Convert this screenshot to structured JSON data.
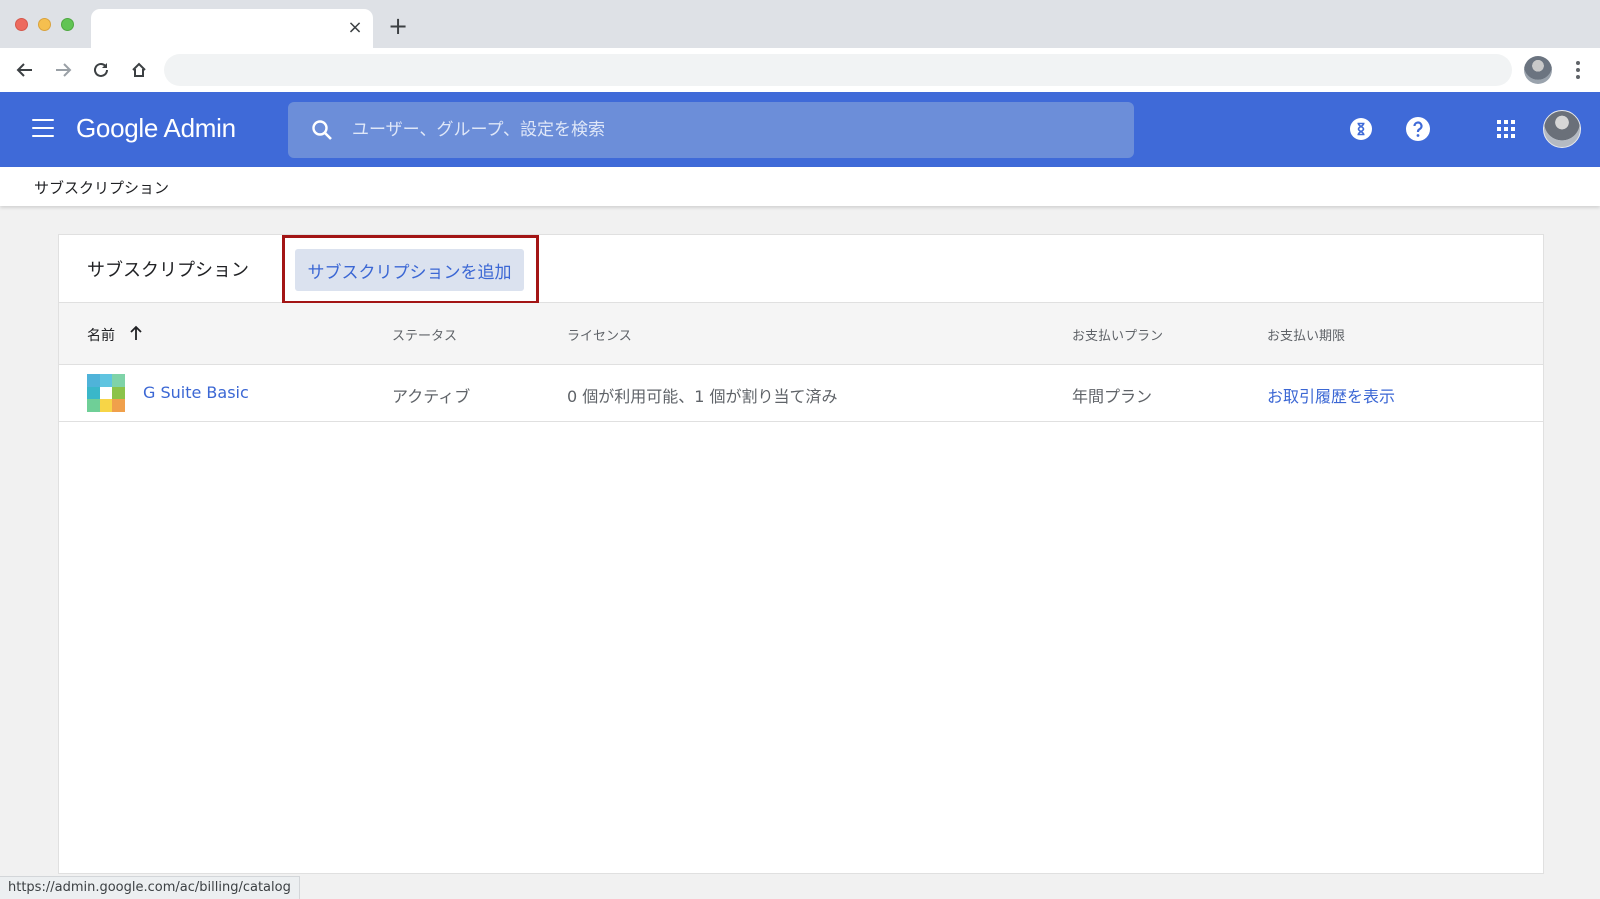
{
  "browser": {
    "tab_close_glyph": "×",
    "new_tab_glyph": "+",
    "status_url": "https://admin.google.com/ac/billing/catalog"
  },
  "header": {
    "brand_google": "Google",
    "brand_admin": "Admin",
    "search_placeholder": "ユーザー、グループ、設定を検索",
    "accent_color": "#3f6ad8"
  },
  "breadcrumb": {
    "current": "サブスクリプション"
  },
  "card": {
    "title": "サブスクリプション",
    "add_button": "サブスクリプションを追加",
    "highlight_color": "#a31515"
  },
  "table": {
    "columns": {
      "name": "名前",
      "status": "ステータス",
      "license": "ライセンス",
      "plan": "お支払いプラン",
      "due": "お支払い期限"
    },
    "rows": [
      {
        "name": "G Suite Basic",
        "status": "アクティブ",
        "license": "0 個が利用可能、1 個が割り当て済み",
        "plan": "年間プラン",
        "action": "お取引履歴を表示"
      }
    ]
  },
  "icons": [
    "back-arrow-icon",
    "forward-arrow-icon",
    "reload-icon",
    "home-icon",
    "menu-icon",
    "search-icon",
    "hourglass-icon",
    "help-icon",
    "apps-grid-icon",
    "sort-ascending-icon",
    "gsuite-logo-icon"
  ]
}
